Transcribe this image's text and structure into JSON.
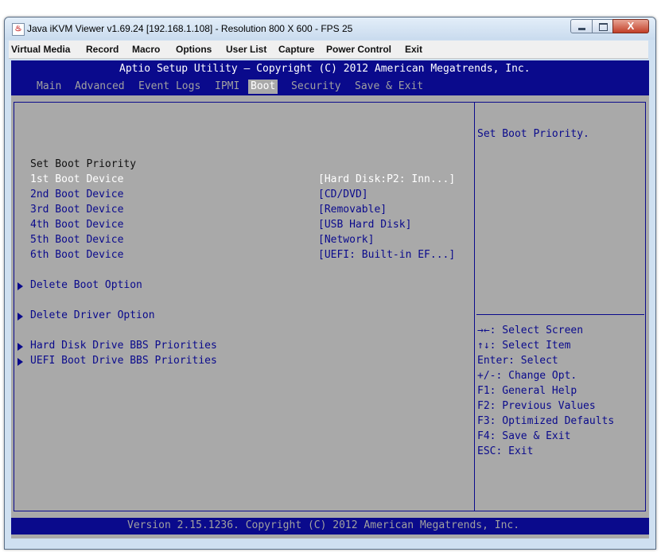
{
  "window": {
    "title": "Java iKVM Viewer v1.69.24 [192.168.1.108]  - Resolution 800 X 600 - FPS 25",
    "close_glyph": "X"
  },
  "menubar": [
    "Virtual Media",
    "Record",
    "Macro",
    "Options",
    "User List",
    "Capture",
    "Power Control",
    "Exit"
  ],
  "bios": {
    "header_title": "Aptio Setup Utility – Copyright (C) 2012 American Megatrends, Inc.",
    "tabs": [
      "Main",
      "Advanced",
      "Event Logs",
      "IPMI",
      "Boot",
      "Security",
      "Save & Exit"
    ],
    "active_tab": "Boot",
    "section_title": "Set Boot Priority",
    "boot_devices": [
      {
        "label": "1st Boot Device",
        "value": "[Hard Disk:P2: Inn...]"
      },
      {
        "label": "2nd Boot Device",
        "value": "[CD/DVD]"
      },
      {
        "label": "3rd Boot Device",
        "value": "[Removable]"
      },
      {
        "label": "4th Boot Device",
        "value": "[USB Hard Disk]"
      },
      {
        "label": "5th Boot Device",
        "value": "[Network]"
      },
      {
        "label": "6th Boot Device",
        "value": "[UEFI: Built-in EF...]"
      }
    ],
    "submenus": [
      "Delete Boot Option",
      "Delete Driver Option",
      "Hard Disk Drive BBS Priorities",
      "UEFI Boot Drive BBS Priorities"
    ],
    "help_text": "Set Boot Priority.",
    "key_help": [
      "→←: Select Screen",
      "↑↓: Select Item",
      "Enter: Select",
      "+/-: Change Opt.",
      "F1: General Help",
      "F2: Previous Values",
      "F3: Optimized Defaults",
      "F4: Save & Exit",
      "ESC: Exit"
    ],
    "footer": "Version 2.15.1236. Copyright (C) 2012 American Megatrends, Inc."
  },
  "colors": {
    "bios_blue": "#0a0a8c",
    "bios_gray": "#a9a9a9",
    "bios_white": "#ffffff"
  }
}
